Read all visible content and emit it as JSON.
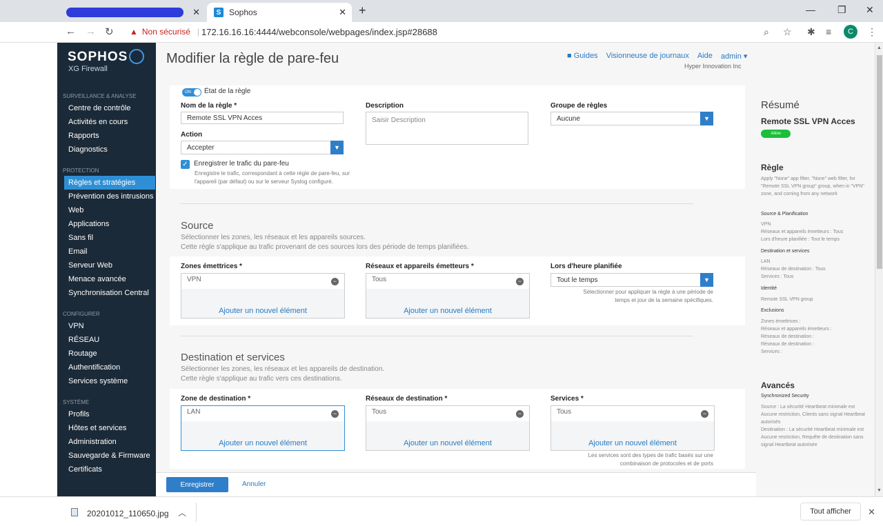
{
  "browser": {
    "tab2_title": "Sophos",
    "favicon_letter": "S",
    "not_secure": "Non sécurisé",
    "url": "172.16.16.16:4444/webconsole/webpages/index.jsp#28688",
    "avatar_letter": "C"
  },
  "sidebar": {
    "logo": "SOPHOS",
    "subtitle": "XG Firewall",
    "sections": [
      {
        "title": "SURVEILLANCE & ANALYSE",
        "items": [
          "Centre de contrôle",
          "Activités en cours",
          "Rapports",
          "Diagnostics"
        ]
      },
      {
        "title": "PROTECTION",
        "items": [
          "Règles et stratégies",
          "Prévention des intrusions",
          "Web",
          "Applications",
          "Sans fil",
          "Email",
          "Serveur Web",
          "Menace avancée",
          "Synchronisation Central"
        ]
      },
      {
        "title": "CONFIGURER",
        "items": [
          "VPN",
          "RÉSEAU",
          "Routage",
          "Authentification",
          "Services système"
        ]
      },
      {
        "title": "SYSTÈME",
        "items": [
          "Profils",
          "Hôtes et services",
          "Administration",
          "Sauvegarde & Firmware",
          "Certificats"
        ]
      }
    ],
    "active": "Règles et stratégies"
  },
  "header": {
    "title": "Modifier la règle de pare-feu",
    "links": [
      "Guides",
      "Visionneuse de journaux",
      "Aide",
      "admin ▾"
    ],
    "company": "Hyper Innovation Inc"
  },
  "form": {
    "toggle": "ON",
    "state_label": "État de la règle",
    "name_label": "Nom de la règle *",
    "name_value": "Remote SSL VPN Acces",
    "description_label": "Description",
    "description_placeholder": "Saisir Description",
    "group_label": "Groupe de règles",
    "group_value": "Aucune",
    "action_label": "Action",
    "action_value": "Accepter",
    "log_label": "Enregistrer le trafic du pare-feu",
    "log_help": "Enregistre le trafic, correspondant à cette règle de pare-feu, sur l'appareil (par défaut) ou sur le serveur Syslog configuré."
  },
  "source": {
    "title": "Source",
    "desc1": "Sélectionner les zones, les réseaux et les appareils sources.",
    "desc2": "Cette règle s'applique au trafic provenant de ces sources lors des période de temps planifiées.",
    "zones_label": "Zones émettrices *",
    "zones_value": "VPN",
    "networks_label": "Réseaux et appareils émetteurs *",
    "networks_value": "Tous",
    "schedule_label": "Lors d'heure planifiée",
    "schedule_value": "Tout le temps",
    "schedule_help": "Sélectionner pour appliquer la règle à une période de temps et jour de la semaine spécifiques.",
    "add": "Ajouter un nouvel élément"
  },
  "destination": {
    "title": "Destination et services",
    "desc1": "Sélectionner les zones, les réseaux et les appareils de destination.",
    "desc2": "Cette règle s'applique au trafic vers ces destinations.",
    "zone_label": "Zone de destination *",
    "zone_value": "LAN",
    "networks_label": "Réseaux de destination *",
    "networks_value": "Tous",
    "services_label": "Services *",
    "services_value": "Tous",
    "services_help": "Les services sont des types de trafic basés sur une combinaison de protocoles et de ports",
    "add": "Ajouter un nouvel élément"
  },
  "actions": {
    "save": "Enregistrer",
    "cancel": "Annuler"
  },
  "summary": {
    "title": "Résumé",
    "rule_name": "Remote SSL VPN Acces",
    "badge": "Allow",
    "rule_heading": "Règle",
    "rule_text": "Apply \"None\" app filter, \"None\" web filter, for \"Remote SSL VPN group\" group, when in \"VPN\" zone, and coming from any network",
    "source_heading": "Source & Planification",
    "source_text": "VPN\nRéseaux et appareils émetteurs : Tous\nLors d'heure planifiée : Tout le temps",
    "dest_heading": "Destination et services",
    "dest_text": "LAN\nRéseaux de destination : Tous\nServices : Tous",
    "identity_heading": "Identité",
    "identity_text": "Remote SSL VPN group",
    "excl_heading": "Exclusions",
    "excl_text": "Zones émettrices :\nRéseaux et appareils émetteurs :\nRéseaux de destination :\nRéseaux de destination :\nServices :",
    "adv_heading": "Avancés",
    "sync_heading": "Synchronized Security",
    "sync_text": "Source : La sécurité Heartbeat minimale est Aucune restriction, Clients sans signal Heartbeat autorisés\nDestination : La sécurité Heartbeat minimale est Aucune restriction, Requête de destination sans signal Heartbeat autorisée"
  },
  "download": {
    "file": "20201012_110650.jpg",
    "show_all": "Tout afficher"
  }
}
